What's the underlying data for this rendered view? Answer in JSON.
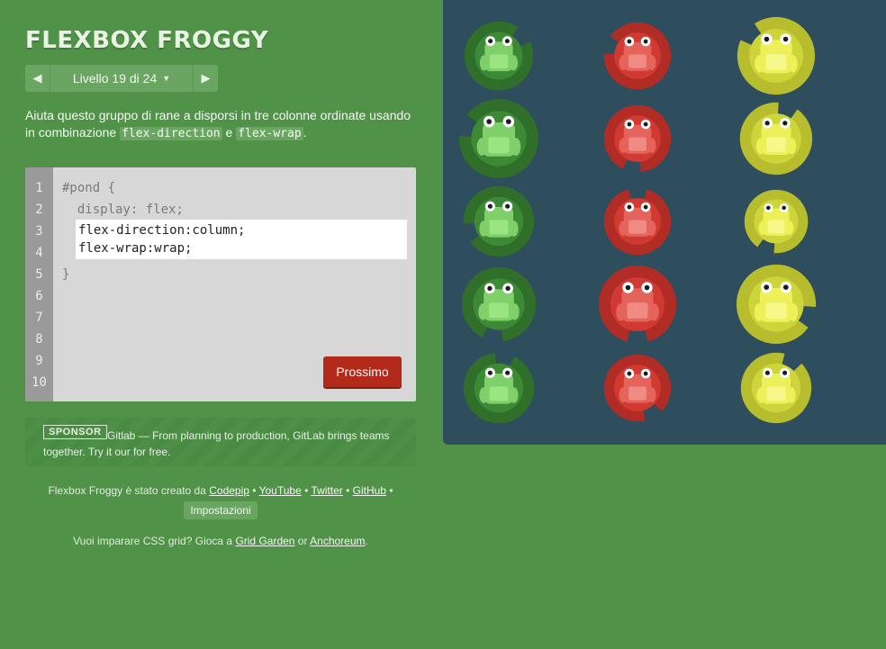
{
  "header": {
    "title": "FLEXBOX FROGGY",
    "level_label": "Livello 19 di 24"
  },
  "instructions": {
    "before": "Aiuta questo gruppo di rane a disporsi in tre colonne ordinate usando in combinazione ",
    "code1": "flex-direction",
    "middle": " e ",
    "code2": "flex-wrap",
    "after": "."
  },
  "editor": {
    "line_numbers": [
      "1",
      "2",
      "3",
      "4",
      "5",
      "6",
      "7",
      "8",
      "9",
      "10"
    ],
    "line1": "#pond {",
    "line2": "  display: flex;",
    "line5": "}",
    "answer": "flex-direction:column;\nflex-wrap:wrap;",
    "next_label": "Prossimo"
  },
  "sponsor": {
    "badge": "SPONSOR",
    "text": "Gitlab — From planning to production, GitLab brings teams together. Try it our for free."
  },
  "credits": {
    "prefix": "Flexbox Froggy è stato creato da ",
    "codepip": "Codepip",
    "sep": " • ",
    "youtube": "YouTube",
    "twitter": "Twitter",
    "github": "GitHub",
    "settings": "Impostazioni"
  },
  "grid_line": {
    "prefix": "Vuoi imparare CSS grid? Gioca a ",
    "grid_garden": "Grid Garden",
    "or": " or ",
    "anchoreum": "Anchoreum",
    "suffix": "."
  },
  "pond": {
    "colors": {
      "green": {
        "pad": "#3c8a36",
        "pad_dark": "#2f6f2a",
        "frog": "#7fcf6b",
        "belly": "#9be482"
      },
      "red": {
        "pad": "#d13a32",
        "pad_dark": "#b02c25",
        "frog": "#e4645c",
        "belly": "#f08b84"
      },
      "yellow": {
        "pad": "#cdd53a",
        "pad_dark": "#b7bd2d",
        "frog": "#eef05a",
        "belly": "#f6f88a"
      }
    },
    "columns": [
      {
        "color": "green",
        "frogs": 5
      },
      {
        "color": "red",
        "frogs": 5
      },
      {
        "color": "yellow",
        "frogs": 5
      }
    ]
  }
}
